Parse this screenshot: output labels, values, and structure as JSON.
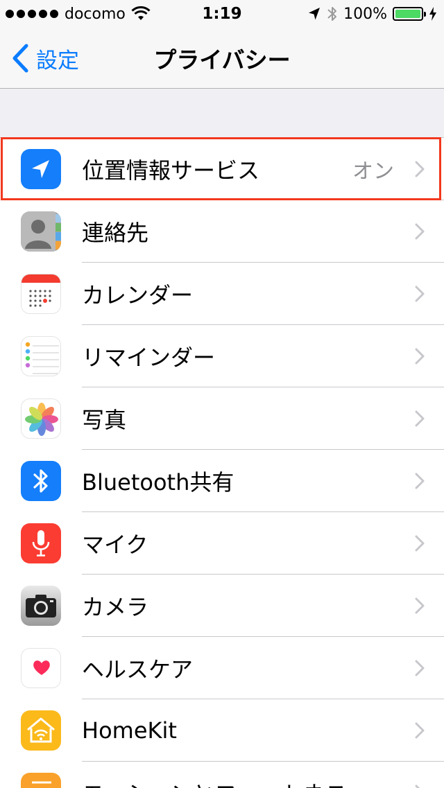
{
  "status_bar": {
    "carrier": "docomo",
    "time": "1:19",
    "battery_percent": "100%",
    "icons": [
      "signal-dots",
      "wifi-icon",
      "location-arrow-icon",
      "bluetooth-icon",
      "battery-icon"
    ]
  },
  "nav": {
    "back_label": "設定",
    "title": "プライバシー"
  },
  "rows": [
    {
      "label": "位置情報サービス",
      "value": "オン",
      "icon": "location-services-icon"
    },
    {
      "label": "連絡先",
      "value": "",
      "icon": "contacts-icon"
    },
    {
      "label": "カレンダー",
      "value": "",
      "icon": "calendar-icon"
    },
    {
      "label": "リマインダー",
      "value": "",
      "icon": "reminders-icon"
    },
    {
      "label": "写真",
      "value": "",
      "icon": "photos-icon"
    },
    {
      "label": "Bluetooth共有",
      "value": "",
      "icon": "bluetooth-share-icon"
    },
    {
      "label": "マイク",
      "value": "",
      "icon": "microphone-icon"
    },
    {
      "label": "カメラ",
      "value": "",
      "icon": "camera-icon"
    },
    {
      "label": "ヘルスケア",
      "value": "",
      "icon": "health-icon"
    },
    {
      "label": "HomeKit",
      "value": "",
      "icon": "homekit-icon"
    },
    {
      "label": "モーションとフィットネス",
      "value": "",
      "icon": "motion-fitness-icon"
    }
  ],
  "colors": {
    "ios_blue": "#0a7cff",
    "highlight": "#f2381e",
    "battery": "#4cd964",
    "secondary_text": "#8e8e93"
  }
}
